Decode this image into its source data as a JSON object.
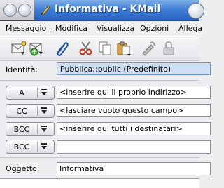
{
  "window": {
    "title": "Informativa - KMail",
    "app_icon": "kmail-quill-icon"
  },
  "menu": [
    {
      "label": "Messaggio",
      "mnemonic_index": 6
    },
    {
      "label": "Modifica",
      "mnemonic_index": 0
    },
    {
      "label": "Visualizza",
      "mnemonic_index": 0
    },
    {
      "label": "Opzioni",
      "mnemonic_index": 0
    },
    {
      "label": "Allega",
      "mnemonic_index": 0
    }
  ],
  "toolbar": [
    "send-mail-icon",
    "queue-mail-icon",
    "attach-icon",
    "cut-icon",
    "copy-icon",
    "paste-icon",
    "spellcheck-icon",
    "encrypt-lock-icon"
  ],
  "identity": {
    "label": "Identità:",
    "value": "Pubblica::public (Predefinito)"
  },
  "recipients": [
    {
      "type": "A",
      "value": "<inserire qui il proprio indirizzo>"
    },
    {
      "type": "CC",
      "value": "<lasciare vuoto questo campo>"
    },
    {
      "type": "BCC",
      "value": "<inserire qui tutti i destinatari>"
    },
    {
      "type": "BCC",
      "value": ""
    }
  ],
  "subject": {
    "label": "Oggetto:",
    "value": "Informativa"
  }
}
